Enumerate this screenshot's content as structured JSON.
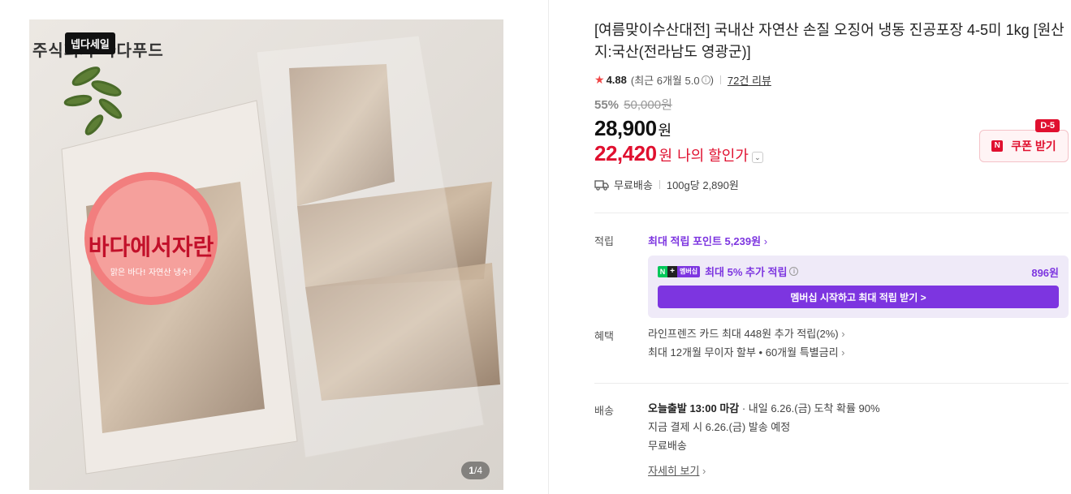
{
  "image": {
    "brand_text": "주식회사 바다푸드",
    "sale_badge": "넵다세일",
    "package_label": "바다에서자란",
    "package_sublabel": "맑은 바다! 자연산 냉수!",
    "counter_current": "1",
    "counter_sep": "/",
    "counter_total": "4"
  },
  "product": {
    "title": "[여름맞이수산대전] 국내산 자연산 손질 오징어 냉동 진공포장 4-5미 1kg [원산지:국산(전라남도 영광군)]",
    "rating": "4.88",
    "rating_recent": "(최근 6개월 5.0",
    "rating_recent_close": ")",
    "review_link": "72건 리뷰"
  },
  "price": {
    "discount_pct": "55%",
    "original": "50,000원",
    "sale": "28,900",
    "sale_unit": "원",
    "my_price": "22,420",
    "my_unit": "원",
    "my_label": "나의 할인가",
    "coupon_label": "쿠폰 받기",
    "coupon_dday": "D-5",
    "shipping": "무료배송",
    "unit_price": "100g당 2,890원"
  },
  "points": {
    "label": "적립",
    "max_point_text": "최대 적립 포인트 5,239원",
    "member_text": "최대 5% 추가 적립",
    "member_badge": "멤버십",
    "member_amount": "896원",
    "member_button": "멤버십 시작하고 최대 적립 받기 >"
  },
  "benefits": {
    "label": "혜택",
    "line1": "라인프렌즈 카드 최대 448원 추가 적립(2%)",
    "line2": "최대 12개월 무이자 할부 • 60개월 특별금리"
  },
  "delivery": {
    "label": "배송",
    "today": "오늘출발 13:00 마감",
    "arrival": "· 내일 6.26.(금) 도착 확률 90%",
    "dispatch": "지금 결제 시 6.26.(금) 발송 예정",
    "fee": "무료배송",
    "detail_link": "자세히 보기"
  },
  "colors": {
    "accent_red": "#e0102f",
    "accent_purple": "#7d35e0",
    "npay_green": "#03c75a"
  }
}
